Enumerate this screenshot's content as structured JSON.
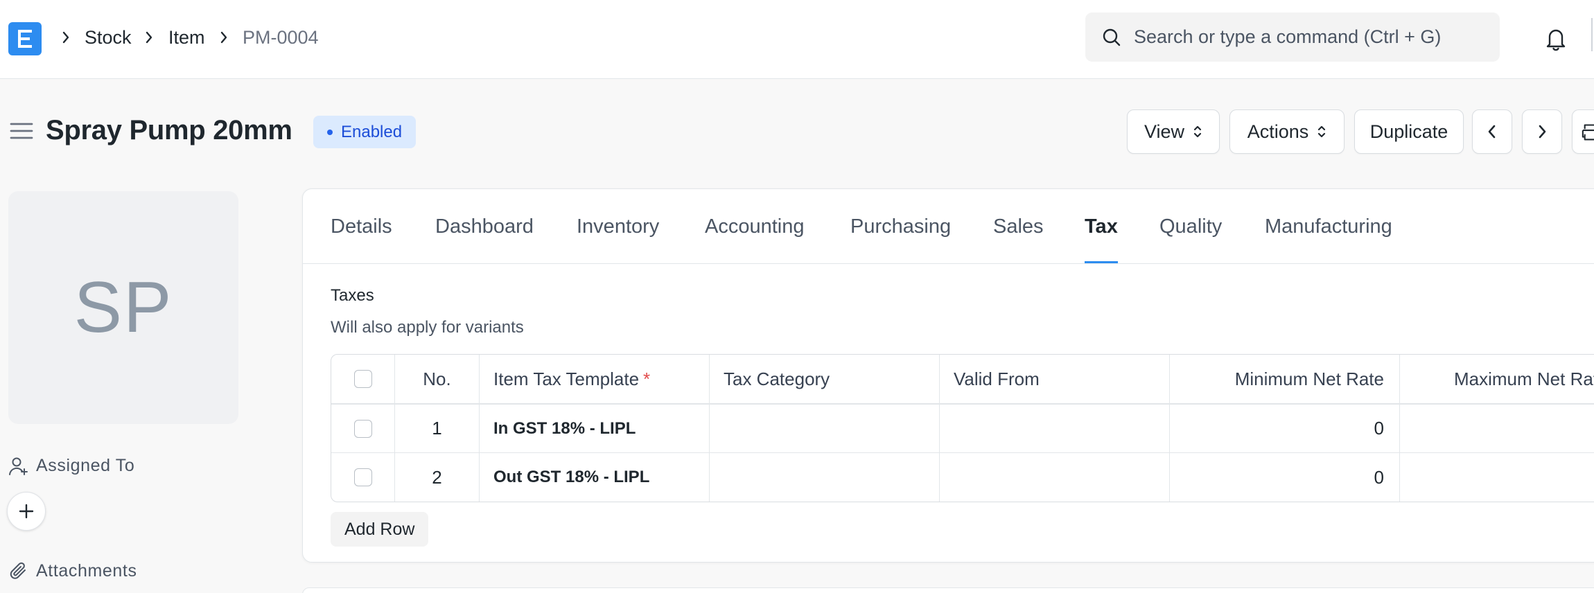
{
  "navbar": {
    "logo_letter": "E",
    "breadcrumbs": [
      "Stock",
      "Item",
      "PM-0004"
    ],
    "search_placeholder": "Search or type a command (Ctrl + G)"
  },
  "page": {
    "title": "Spray Pump 20mm",
    "status": "Enabled",
    "buttons": {
      "view": "View",
      "actions": "Actions",
      "duplicate": "Duplicate"
    }
  },
  "sidebar": {
    "avatar_initials": "SP",
    "assigned_to": "Assigned To",
    "attachments": "Attachments"
  },
  "tabs": [
    "Details",
    "Dashboard",
    "Inventory",
    "Accounting",
    "Purchasing",
    "Sales",
    "Tax",
    "Quality",
    "Manufacturing"
  ],
  "active_tab": "Tax",
  "taxes": {
    "label": "Taxes",
    "description": "Will also apply for variants",
    "columns": {
      "no": "No.",
      "item_tax_template": "Item Tax Template",
      "required_mark": "*",
      "tax_category": "Tax Category",
      "valid_from": "Valid From",
      "min_net_rate": "Minimum Net Rate",
      "max_net_rate": "Maximum Net Rate"
    },
    "rows": [
      {
        "no": "1",
        "item_tax_template": "In GST 18% - LIPL",
        "tax_category": "",
        "valid_from": "",
        "min_net_rate": "0",
        "max_net_rate": ""
      },
      {
        "no": "2",
        "item_tax_template": "Out GST 18% - LIPL",
        "tax_category": "",
        "valid_from": "",
        "min_net_rate": "0",
        "max_net_rate": ""
      }
    ],
    "add_row": "Add Row"
  },
  "colors": {
    "accent": "#2d8cf0",
    "status_bg": "#dbeafe",
    "status_text": "#1d4ed8",
    "required": "#e24c4c"
  }
}
